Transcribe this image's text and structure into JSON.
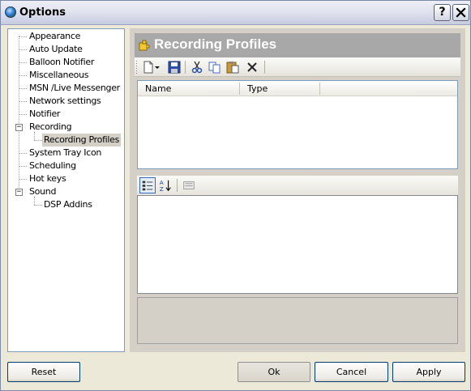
{
  "window": {
    "title": "Options",
    "help_label": "?",
    "close_label": "✕"
  },
  "tree": {
    "items": [
      {
        "label": "Appearance"
      },
      {
        "label": "Auto Update"
      },
      {
        "label": "Balloon Notifier"
      },
      {
        "label": "Miscellaneous"
      },
      {
        "label": "MSN /Live Messenger"
      },
      {
        "label": "Network settings"
      },
      {
        "label": "Notifier"
      },
      {
        "label": "Recording",
        "expander": "−"
      },
      {
        "label": "Recording Profiles"
      },
      {
        "label": "System Tray Icon"
      },
      {
        "label": "Scheduling"
      },
      {
        "label": "Hot keys"
      },
      {
        "label": "Sound",
        "expander": "−"
      },
      {
        "label": "DSP Addins"
      }
    ],
    "selected": "Recording Profiles"
  },
  "panel": {
    "title": "Recording Profiles",
    "toolbar_icons": [
      "new-document-icon",
      "dropdown-arrow-icon",
      "save-icon",
      "cut-icon",
      "copy-icon",
      "paste-icon",
      "delete-icon"
    ],
    "list": {
      "columns": [
        "Name",
        "Type"
      ],
      "rows": []
    },
    "property_toolbar_icons": [
      "categorized-icon",
      "alphabetical-sort-icon",
      "property-pages-icon"
    ]
  },
  "buttons": {
    "reset": "Reset",
    "ok": "Ok",
    "cancel": "Cancel",
    "apply": "Apply"
  },
  "colors": {
    "header_bar": "#a8a8a8",
    "header_text": "#ffffff",
    "selection": "#d4d0c8",
    "window_bg": "#ece9d8"
  }
}
